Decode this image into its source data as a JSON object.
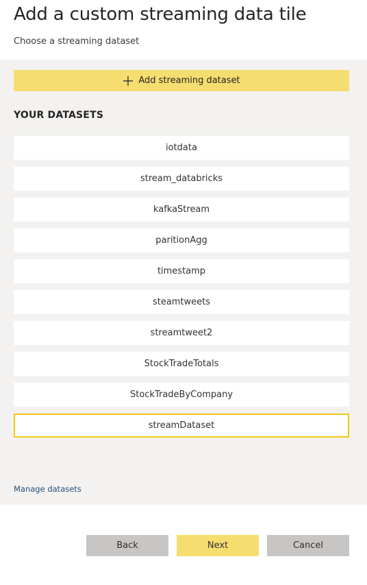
{
  "header": {
    "title": "Add a custom streaming data tile",
    "subtitle": "Choose a streaming dataset"
  },
  "add_button": {
    "label": "Add streaming dataset",
    "icon": "plus-icon"
  },
  "datasets": {
    "heading": "YOUR DATASETS",
    "items": [
      {
        "label": "iotdata",
        "selected": false
      },
      {
        "label": "stream_databricks",
        "selected": false
      },
      {
        "label": "kafkaStream",
        "selected": false
      },
      {
        "label": "paritionAgg",
        "selected": false
      },
      {
        "label": "timestamp",
        "selected": false
      },
      {
        "label": "steamtweets",
        "selected": false
      },
      {
        "label": "streamtweet2",
        "selected": false
      },
      {
        "label": "StockTradeTotals",
        "selected": false
      },
      {
        "label": "StockTradeByCompany",
        "selected": false
      },
      {
        "label": "streamDataset",
        "selected": true
      }
    ]
  },
  "manage_link": "Manage datasets",
  "footer": {
    "back_label": "Back",
    "next_label": "Next",
    "cancel_label": "Cancel"
  },
  "colors": {
    "accent_yellow": "#f6dd6f",
    "selected_border": "#f2c811",
    "panel_bg": "#f3f2f1",
    "secondary_button": "#c8c6c4",
    "link": "#1f4e79"
  }
}
